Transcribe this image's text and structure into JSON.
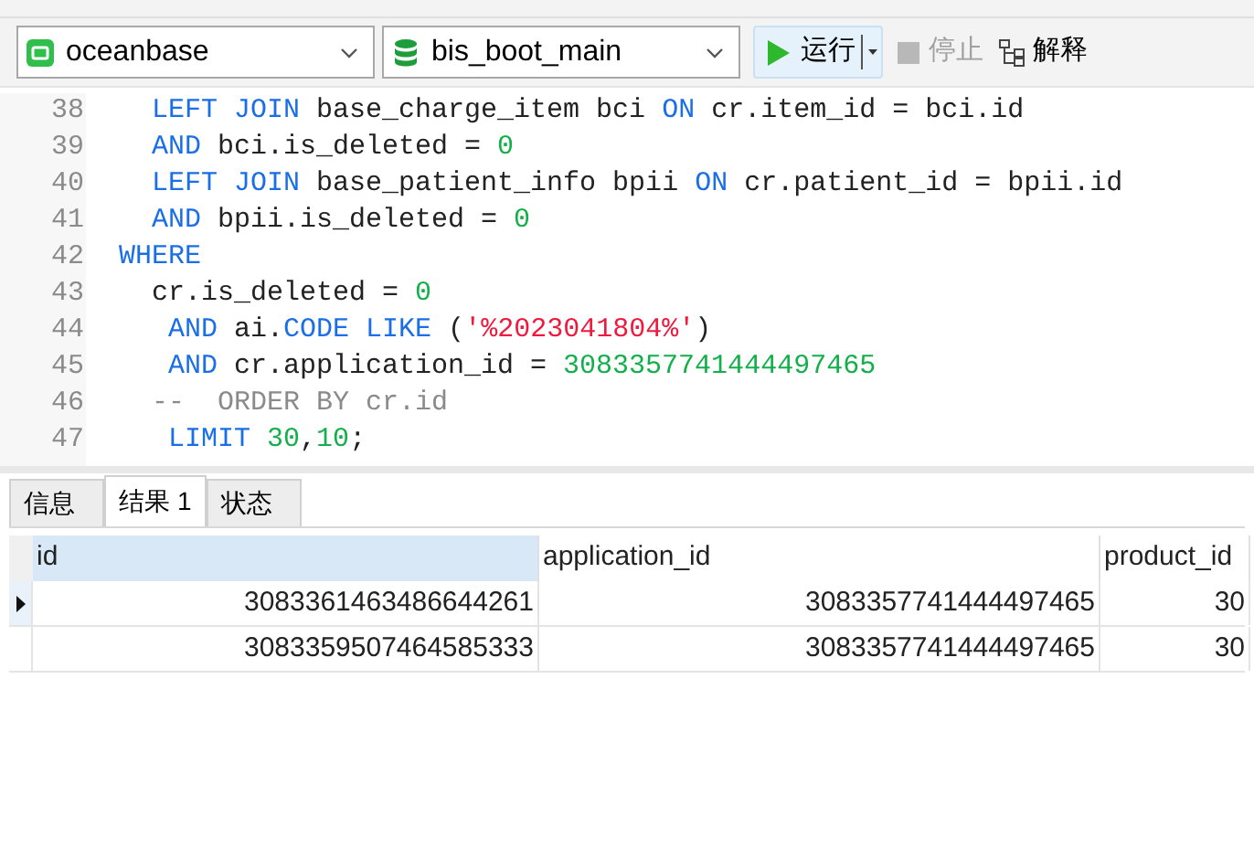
{
  "toolbar": {
    "connection": {
      "value": "oceanbase"
    },
    "database": {
      "value": "bis_boot_main"
    },
    "buttons": [
      {
        "kind": "run",
        "label": "运行",
        "disabled": false
      },
      {
        "kind": "stop",
        "label": "停止",
        "disabled": true
      },
      {
        "kind": "explain",
        "label": "解释",
        "disabled": false
      }
    ]
  },
  "editor": {
    "lines": [
      {
        "number": "38",
        "tokens": [
          {
            "kind": "kw",
            "text": "  LEFT JOIN"
          },
          {
            "kind": "plain",
            "text": " base_charge_item bci "
          },
          {
            "kind": "kw",
            "text": "ON"
          },
          {
            "kind": "plain",
            "text": " cr.item_id = bci.id"
          }
        ]
      },
      {
        "number": "39",
        "tokens": [
          {
            "kind": "kw",
            "text": "  AND"
          },
          {
            "kind": "plain",
            "text": " bci.is_deleted = "
          },
          {
            "kind": "num",
            "text": "0"
          }
        ]
      },
      {
        "number": "40",
        "tokens": [
          {
            "kind": "kw",
            "text": "  LEFT JOIN"
          },
          {
            "kind": "plain",
            "text": " base_patient_info bpii "
          },
          {
            "kind": "kw",
            "text": "ON"
          },
          {
            "kind": "plain",
            "text": " cr.patient_id = bpii.id"
          }
        ]
      },
      {
        "number": "41",
        "tokens": [
          {
            "kind": "kw",
            "text": "  AND"
          },
          {
            "kind": "plain",
            "text": " bpii.is_deleted = "
          },
          {
            "kind": "num",
            "text": "0"
          }
        ]
      },
      {
        "number": "42",
        "tokens": [
          {
            "kind": "kw",
            "text": "WHERE"
          }
        ]
      },
      {
        "number": "43",
        "tokens": [
          {
            "kind": "plain",
            "text": "  cr.is_deleted = "
          },
          {
            "kind": "num",
            "text": "0"
          }
        ]
      },
      {
        "number": "44",
        "tokens": [
          {
            "kind": "kw",
            "text": "   AND"
          },
          {
            "kind": "plain",
            "text": " ai."
          },
          {
            "kind": "kw",
            "text": "CODE LIKE"
          },
          {
            "kind": "plain",
            "text": " ("
          },
          {
            "kind": "str",
            "text": "'%2023041804%'"
          },
          {
            "kind": "plain",
            "text": ")"
          }
        ]
      },
      {
        "number": "45",
        "tokens": [
          {
            "kind": "kw",
            "text": "   AND"
          },
          {
            "kind": "plain",
            "text": " cr.application_id = "
          },
          {
            "kind": "num",
            "text": "3083357741444497465"
          }
        ]
      },
      {
        "number": "46",
        "tokens": [
          {
            "kind": "comment",
            "text": "  --  ORDER BY cr.id"
          }
        ]
      },
      {
        "number": "47",
        "tokens": [
          {
            "kind": "kw",
            "text": "   LIMIT"
          },
          {
            "kind": "num",
            "text": " 30"
          },
          {
            "kind": "plain",
            "text": ","
          },
          {
            "kind": "num",
            "text": "10"
          },
          {
            "kind": "plain",
            "text": ";"
          }
        ]
      }
    ]
  },
  "result_tabs": [
    {
      "label": "信息",
      "selected": false
    },
    {
      "label": "结果 1",
      "selected": true
    },
    {
      "label": "状态",
      "selected": false
    }
  ],
  "table": {
    "columns": [
      {
        "label": "id",
        "selected": true
      },
      {
        "label": "application_id",
        "selected": false
      },
      {
        "label": "product_id",
        "selected": false
      }
    ],
    "rows": [
      {
        "current": true,
        "cells": [
          "3083361463486644261",
          "3083357741444497465",
          "30"
        ]
      },
      {
        "current": false,
        "cells": [
          "3083359507464585333",
          "3083357741444497465",
          "30"
        ]
      }
    ]
  }
}
